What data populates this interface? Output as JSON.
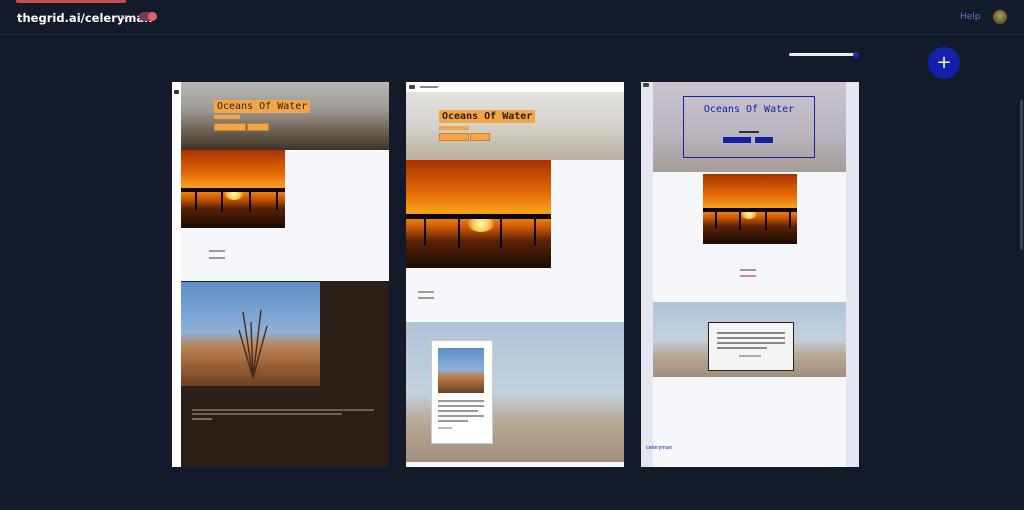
{
  "header": {
    "site_title": "thegrid.ai/celeryman",
    "help_label": "Help"
  },
  "toolbar": {
    "add_label": "+",
    "zoom_level": 0.95
  },
  "previews": [
    {
      "name": "layout-1",
      "hero_title": "Oceans Of Water"
    },
    {
      "name": "layout-2",
      "hero_title": "Oceans Of Water"
    },
    {
      "name": "layout-3",
      "hero_title": "Oceans Of Water",
      "footer_label": "celeryman"
    }
  ],
  "colors": {
    "background": "#131a29",
    "accent_blue": "#1221a6",
    "accent_orange": "#f3a648",
    "toggle_red": "#e0606c"
  }
}
